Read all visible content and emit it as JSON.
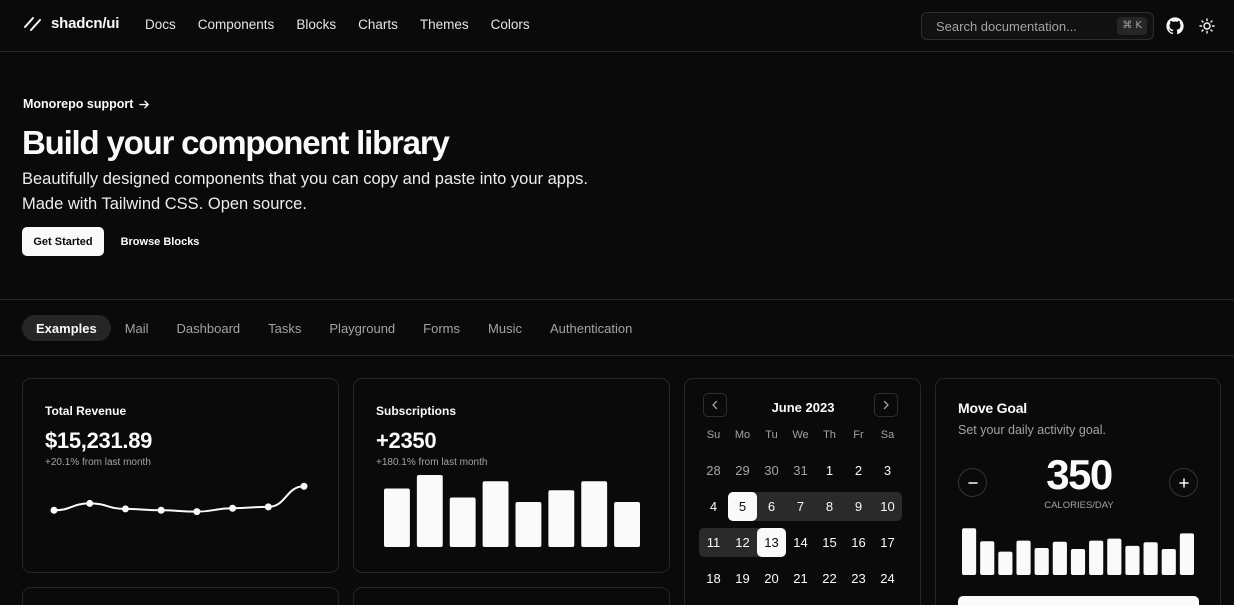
{
  "header": {
    "brand": "shadcn/ui",
    "nav": [
      "Docs",
      "Components",
      "Blocks",
      "Charts",
      "Themes",
      "Colors"
    ],
    "search_placeholder": "Search documentation...",
    "search_shortcut": "⌘ K",
    "icons": [
      "github-icon",
      "sun-icon"
    ]
  },
  "hero": {
    "announcement": "Monorepo support",
    "announcement_icon": "arrow-right-icon",
    "title": "Build your component library",
    "description_line1": "Beautifully designed components that you can copy and paste into your apps.",
    "description_line2": "Made with Tailwind CSS. Open source.",
    "primary_button": "Get Started",
    "secondary_button": "Browse Blocks"
  },
  "tabs": {
    "items": [
      "Examples",
      "Mail",
      "Dashboard",
      "Tasks",
      "Playground",
      "Forms",
      "Music",
      "Authentication"
    ],
    "active": "Examples"
  },
  "revenue_card": {
    "label": "Total Revenue",
    "value": "$15,231.89",
    "sub": "+20.1% from last month"
  },
  "subscriptions_card": {
    "label": "Subscriptions",
    "value": "+2350",
    "sub": "+180.1% from last month"
  },
  "calendar": {
    "month": "June 2023",
    "weekdays": [
      "Su",
      "Mo",
      "Tu",
      "We",
      "Th",
      "Fr",
      "Sa"
    ],
    "rows": [
      [
        "28",
        "29",
        "30",
        "31",
        "1",
        "2",
        "3"
      ],
      [
        "4",
        "5",
        "6",
        "7",
        "8",
        "9",
        "10"
      ],
      [
        "11",
        "12",
        "13",
        "14",
        "15",
        "16",
        "17"
      ],
      [
        "18",
        "19",
        "20",
        "21",
        "22",
        "23",
        "24"
      ]
    ],
    "muted_days": [
      "28",
      "29",
      "30",
      "31"
    ],
    "selected_days": [
      "5",
      "13"
    ],
    "range": [
      "5",
      "13"
    ]
  },
  "goal_card": {
    "title": "Move Goal",
    "subtitle": "Set your daily activity goal.",
    "value": "350",
    "unit": "CALORIES/DAY",
    "minus_icon": "minus-icon",
    "plus_icon": "plus-icon"
  },
  "chart_data": [
    {
      "type": "line",
      "x": [
        1,
        2,
        3,
        4,
        5,
        6,
        7,
        8
      ],
      "values": [
        20,
        30,
        22,
        20,
        18,
        23,
        25,
        55
      ],
      "ylim": [
        0,
        70
      ],
      "grid": false
    },
    {
      "type": "bar",
      "values": [
        65,
        80,
        55,
        73,
        50,
        63,
        73,
        50
      ],
      "ylim": [
        0,
        80
      ],
      "grid": false
    },
    {
      "type": "bar",
      "values": [
        90,
        65,
        45,
        66,
        52,
        64,
        50,
        66,
        70,
        56,
        63,
        50,
        80
      ],
      "ylim": [
        0,
        100
      ],
      "grid": false
    }
  ],
  "colors": {
    "background": "#0a0a0a",
    "foreground": "#fafafa",
    "muted": "#a3a3a3",
    "border": "#262626"
  }
}
